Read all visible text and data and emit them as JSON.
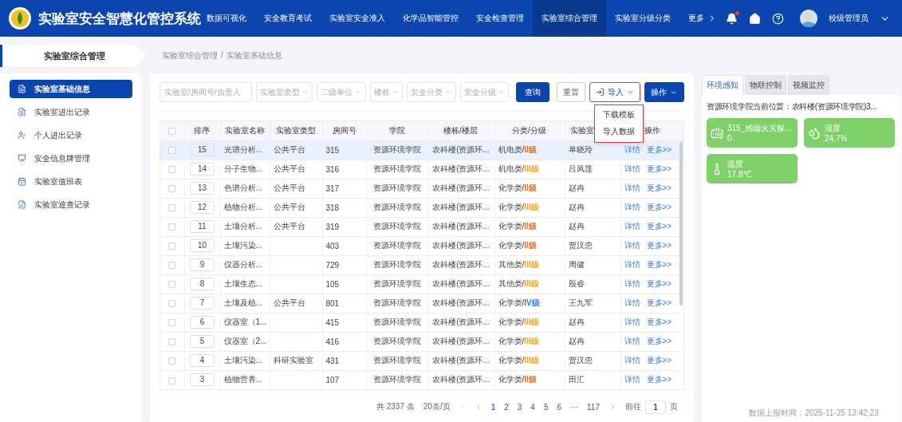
{
  "app": {
    "title": "实验室安全智慧化管控系统"
  },
  "nav": [
    {
      "label": "数据可视化",
      "selected": false
    },
    {
      "label": "安全教育考试",
      "selected": false
    },
    {
      "label": "实验室安全准入",
      "selected": false
    },
    {
      "label": "化学品智能管控",
      "selected": false
    },
    {
      "label": "安全检查管理",
      "selected": false
    },
    {
      "label": "实验室综合管理",
      "selected": true
    },
    {
      "label": "实验室分级分类",
      "selected": false
    }
  ],
  "nav_more": "更多",
  "user": {
    "name": "校级管理员",
    "notification": true
  },
  "sidebar": {
    "title": "实验室综合管理",
    "items": [
      {
        "label": "实验室基础信息",
        "selected": true,
        "kind": "info"
      },
      {
        "label": "实验室进出记录",
        "selected": false,
        "kind": "log"
      },
      {
        "label": "个人进出记录",
        "selected": false,
        "kind": "person"
      },
      {
        "label": "安全信息牌管理",
        "selected": false,
        "kind": "board"
      },
      {
        "label": "实验室值班表",
        "selected": false,
        "kind": "duty"
      },
      {
        "label": "实验室巡查记录",
        "selected": false,
        "kind": "patrol"
      }
    ]
  },
  "breadcrumb": [
    "实验室综合管理",
    "实验室基础信息"
  ],
  "breadcrumb_separator": "/",
  "filters": {
    "search": {
      "placeholder": "实验室/房间号/负责人"
    },
    "selects": [
      "实验室类型",
      "二级单位",
      "楼栋",
      "安全分类",
      "安全分级"
    ]
  },
  "buttons": {
    "query": "查询",
    "reset": "重置",
    "import": "导入",
    "actions": "操作"
  },
  "import_menu": [
    "下载模板",
    "导入数据"
  ],
  "table": {
    "header_checked": false,
    "columns": [
      "排序",
      "实验室名称",
      "实验室类型",
      "房间号",
      "学院",
      "楼栋/楼层",
      "分类/分级",
      "实验室",
      "操作"
    ],
    "rows": [
      {
        "selected": true,
        "checked": false,
        "order": "15",
        "name": "光谱分析...",
        "type": "公共平台",
        "room": "315",
        "college": "资源环境学院",
        "building": "农科楼(资源环...",
        "category": "机电类/",
        "grade": "II级",
        "color": "#f06a1f",
        "manager": "单晓玲",
        "detail": "详情",
        "more": "更多>>"
      },
      {
        "selected": false,
        "checked": false,
        "order": "14",
        "name": "分子生物...",
        "type": "公共平台",
        "room": "316",
        "college": "资源环境学院",
        "building": "农科楼(资源环...",
        "category": "机电类/",
        "grade": "III级",
        "color": "#f5a623",
        "manager": "吕凤莲",
        "detail": "详情",
        "more": "更多>>"
      },
      {
        "selected": false,
        "checked": false,
        "order": "13",
        "name": "色谱分析...",
        "type": "公共平台",
        "room": "317",
        "college": "资源环境学院",
        "building": "农科楼(资源环...",
        "category": "化学类/",
        "grade": "II级",
        "color": "#f06a1f",
        "manager": "赵冉",
        "detail": "详情",
        "more": "更多>>"
      },
      {
        "selected": false,
        "checked": false,
        "order": "12",
        "name": "植物分析...",
        "type": "公共平台",
        "room": "318",
        "college": "资源环境学院",
        "building": "农科楼(资源环...",
        "category": "化学类/",
        "grade": "III级",
        "color": "#f5a623",
        "manager": "赵冉",
        "detail": "详情",
        "more": "更多>>"
      },
      {
        "selected": false,
        "checked": false,
        "order": "11",
        "name": "土壤分析...",
        "type": "公共平台",
        "room": "319",
        "college": "资源环境学院",
        "building": "农科楼(资源环...",
        "category": "化学类/",
        "grade": "II级",
        "color": "#f06a1f",
        "manager": "赵冉",
        "detail": "详情",
        "more": "更多>>"
      },
      {
        "selected": false,
        "checked": false,
        "order": "10",
        "name": "土壤污染...",
        "room": "403",
        "college": "资源环境学院",
        "building": "农科楼(资源环...",
        "category": "化学类/",
        "grade": "II级",
        "color": "#f06a1f",
        "manager": "贾汉忠",
        "detail": "详情",
        "more": "更多>>"
      },
      {
        "selected": false,
        "checked": false,
        "order": "9",
        "name": "仪器分析...",
        "room": "729",
        "college": "资源环境学院",
        "building": "农科楼(资源环...",
        "category": "其他类/",
        "grade": "III级",
        "color": "#f5a623",
        "manager": "周健",
        "detail": "详情",
        "more": "更多>>"
      },
      {
        "selected": false,
        "checked": false,
        "order": "8",
        "name": "土壤生态...",
        "room": "105",
        "college": "资源环境学院",
        "building": "农科楼(资源环...",
        "category": "其他类/",
        "grade": "III级",
        "color": "#f5a623",
        "manager": "殷睿",
        "detail": "详情",
        "more": "更多>>"
      },
      {
        "selected": false,
        "checked": false,
        "order": "7",
        "name": "土壤及植...",
        "type": "公共平台",
        "room": "801",
        "college": "资源环境学院",
        "building": "农科楼(资源环...",
        "category": "化学类/",
        "grade": "IV级",
        "color": "#2d7cf0",
        "manager": "王九军",
        "detail": "详情",
        "more": "更多>>"
      },
      {
        "selected": false,
        "checked": false,
        "order": "6",
        "name": "仪器室（1...",
        "room": "415",
        "college": "资源环境学院",
        "building": "农科楼(资源环...",
        "category": "化学类/",
        "grade": "III级",
        "color": "#f5a623",
        "manager": "赵冉",
        "detail": "详情",
        "more": "更多>>"
      },
      {
        "selected": false,
        "checked": false,
        "order": "5",
        "name": "仪器室（2...",
        "room": "416",
        "college": "资源环境学院",
        "building": "农科楼(资源环...",
        "category": "化学类/",
        "grade": "III级",
        "color": "#f5a623",
        "manager": "赵冉",
        "detail": "详情",
        "more": "更多>>"
      },
      {
        "selected": false,
        "checked": false,
        "order": "4",
        "name": "土壤污染...",
        "type": "科研实验室",
        "room": "431",
        "college": "资源环境学院",
        "building": "农科楼(资源环...",
        "category": "化学类/",
        "grade": "III级",
        "color": "#f5a623",
        "manager": "贾汉忠",
        "detail": "详情",
        "more": "更多>>"
      },
      {
        "selected": false,
        "checked": false,
        "order": "3",
        "name": "植物营养...",
        "room": "107",
        "college": "资源环境学院",
        "building": "农科楼(资源环...",
        "category": "化学类/",
        "grade": "II级",
        "color": "#f06a1f",
        "manager": "田汇",
        "detail": "详情",
        "more": "更多>>"
      }
    ]
  },
  "pagination": {
    "total": "共 2337 条",
    "page_size": "20条/页",
    "pages": [
      {
        "label": "1",
        "selected": true
      },
      {
        "label": "2",
        "selected": false
      },
      {
        "label": "3",
        "selected": false
      },
      {
        "label": "4",
        "selected": false
      },
      {
        "label": "5",
        "selected": false
      },
      {
        "label": "6",
        "selected": false
      },
      {
        "label": "···",
        "selected": false
      },
      {
        "label": "117",
        "selected": false
      }
    ],
    "goto_label": "前往",
    "goto_value": "1",
    "page_unit": "页"
  },
  "right_panel": {
    "tabs": [
      {
        "label": "环境感知",
        "selected": true
      },
      {
        "label": "物联控制",
        "selected": false
      },
      {
        "label": "视频监控",
        "selected": false
      }
    ],
    "location": "资源环境学院当前位置：农科楼(资源环境学院)3...",
    "sensors": [
      {
        "kind": "smoke",
        "name": "315_感烟火灾探...",
        "value": "0-"
      },
      {
        "kind": "humidity",
        "name": "湿度",
        "value": "24.7%"
      },
      {
        "kind": "temperature",
        "name": "温度",
        "value": "17.8℃"
      }
    ],
    "report_time": "数据上报时间：2025-11-25 13:42:23"
  }
}
